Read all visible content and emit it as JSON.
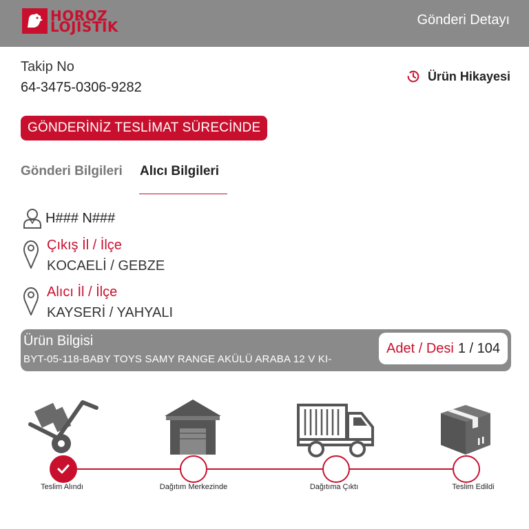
{
  "header": {
    "logo_line1": "HOROZ",
    "logo_line2": "LOJİSTİK",
    "title": "Gönderi Detayı"
  },
  "tracking": {
    "label": "Takip No",
    "number": "64-3475-0306-9282"
  },
  "history_link": {
    "label": "Ürün Hikayesi",
    "icon": "history-icon"
  },
  "status_badge": "GÖNDERİNİZ TESLİMAT SÜRECİNDE",
  "tabs": [
    {
      "label": "Gönderi Bilgileri",
      "active": false
    },
    {
      "label": "Alıcı Bilgileri",
      "active": true
    }
  ],
  "recipient": {
    "name": "H### N###",
    "origin_label": "Çıkış İl / İlçe",
    "origin_value": "KOCAELİ / GEBZE",
    "destination_label": "Alıcı İl / İlçe",
    "destination_value": "KAYSERİ / YAHYALI"
  },
  "product": {
    "title": "Ürün Bilgisi",
    "description": "BYT-05-118-BABY TOYS SAMY RANGE AKÜLÜ ARABA 12 V KI-",
    "qty_label": "Adet / Desi",
    "qty_value": "1 / 104"
  },
  "timeline": [
    {
      "label": "Teslim Alındı",
      "icon": "hand-truck-icon",
      "done": true
    },
    {
      "label": "Dağıtım Merkezinde",
      "icon": "warehouse-icon",
      "done": false
    },
    {
      "label": "Dağıtıma Çıktı",
      "icon": "delivery-truck-icon",
      "done": false
    },
    {
      "label": "Teslim Edildi",
      "icon": "box-icon",
      "done": false
    }
  ],
  "colors": {
    "brand_red": "#c8102e",
    "header_gray": "#8a8a8a",
    "icon_gray": "#555555"
  }
}
